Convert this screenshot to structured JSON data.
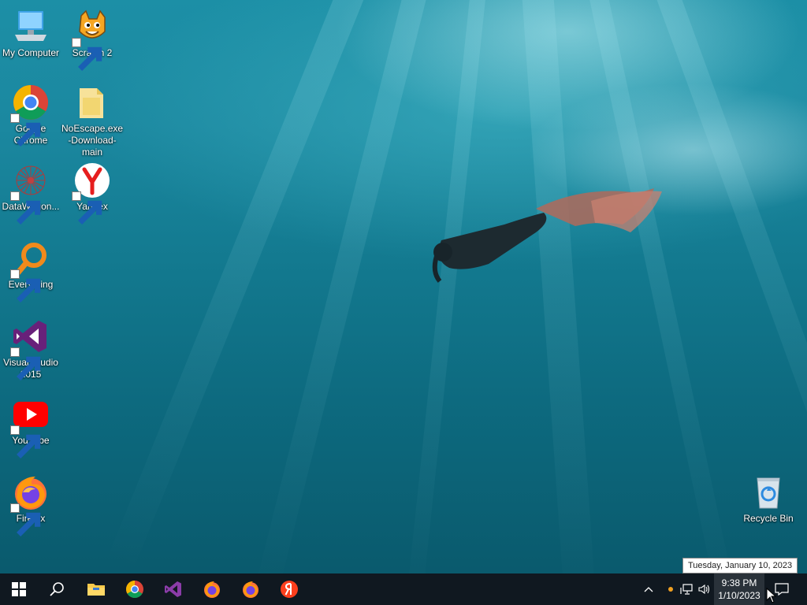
{
  "desktop": {
    "icons": [
      {
        "label": "My Computer"
      },
      {
        "label": "Scratch 2"
      },
      {
        "label": "Google Chrome"
      },
      {
        "label": "NoEscape.exe -Download-main"
      },
      {
        "label": "DataWagon..."
      },
      {
        "label": "Yandex"
      },
      {
        "label": "Everything"
      },
      {
        "label": "Visual Studio 2015"
      },
      {
        "label": "YouTube"
      },
      {
        "label": "Firefox"
      },
      {
        "label": "Recycle Bin"
      }
    ]
  },
  "taskbar": {
    "clock_time": "9:38 PM",
    "clock_date": "1/10/2023",
    "tooltip": "Tuesday, January 10, 2023",
    "pinned": [
      "start-icon",
      "search-icon",
      "file-explorer-icon",
      "chrome-icon",
      "visual-studio-icon",
      "firefox-icon",
      "firefox-icon",
      "yandex-icon"
    ]
  },
  "colors": {
    "taskbar": "#101820",
    "accent_youtube": "#ff0000",
    "accent_vs": "#68217a",
    "accent_everything": "#f08a1c"
  }
}
